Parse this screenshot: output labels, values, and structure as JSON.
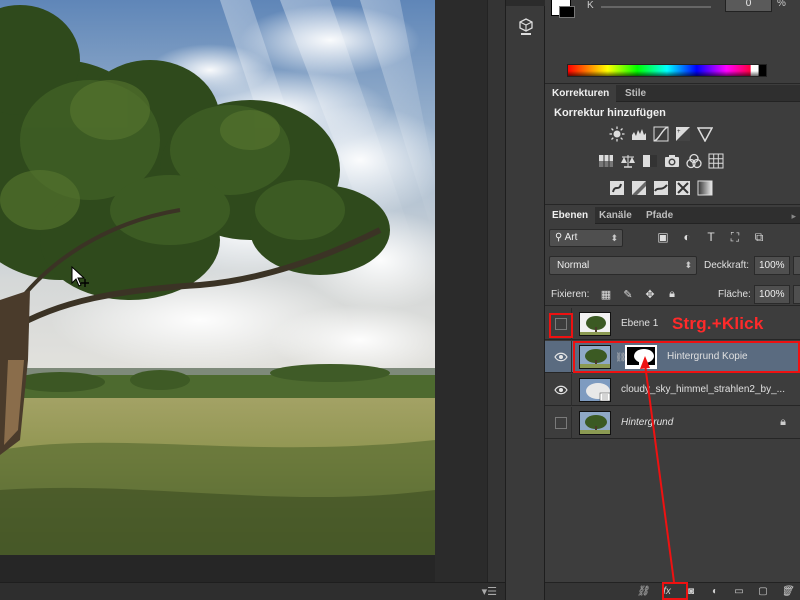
{
  "color_panel": {
    "channel_label": "K",
    "channel_value": "0",
    "unit": "%"
  },
  "adjustments": {
    "tabs": [
      "Korrekturen",
      "Stile"
    ],
    "heading": "Korrektur hinzufügen",
    "icons_row1": [
      "brightness-icon",
      "levels-icon",
      "curves-icon",
      "exposure-icon",
      "vibrance-icon"
    ],
    "icons_row2": [
      "hue-saturation-icon",
      "color-balance-icon",
      "black-white-icon",
      "photo-filter-icon",
      "channel-mixer-icon",
      "color-lookup-icon"
    ],
    "icons_row3": [
      "invert-icon",
      "posterize-icon",
      "threshold-icon",
      "selective-color-icon",
      "gradient-map-icon"
    ]
  },
  "layers_panel": {
    "tabs": [
      "Ebenen",
      "Kanäle",
      "Pfade"
    ],
    "filter_kind": "Art",
    "blend_mode": "Normal",
    "opacity_label": "Deckkraft:",
    "opacity_value": "100%",
    "lock_label": "Fixieren:",
    "fill_label": "Fläche:",
    "fill_value": "100%",
    "layers": [
      {
        "name": "Ebene 1",
        "visible": false,
        "selected": false,
        "has_mask": false,
        "locked": false,
        "italic": false
      },
      {
        "name": "Hintergrund Kopie",
        "visible": true,
        "selected": true,
        "has_mask": true,
        "locked": false,
        "italic": false
      },
      {
        "name": "cloudy_sky_himmel_strahlen2_by_...",
        "visible": true,
        "selected": false,
        "has_mask": false,
        "locked": false,
        "italic": false
      },
      {
        "name": "Hintergrund",
        "visible": false,
        "selected": false,
        "has_mask": false,
        "locked": true,
        "italic": true
      }
    ]
  },
  "annotation": {
    "label": "Strg.+Klick",
    "color": "#e11111"
  },
  "footer_icons": [
    "link-layers-icon",
    "fx-icon",
    "add-mask-icon",
    "adjustment-layer-icon",
    "new-group-icon",
    "new-layer-icon",
    "delete-layer-icon"
  ]
}
